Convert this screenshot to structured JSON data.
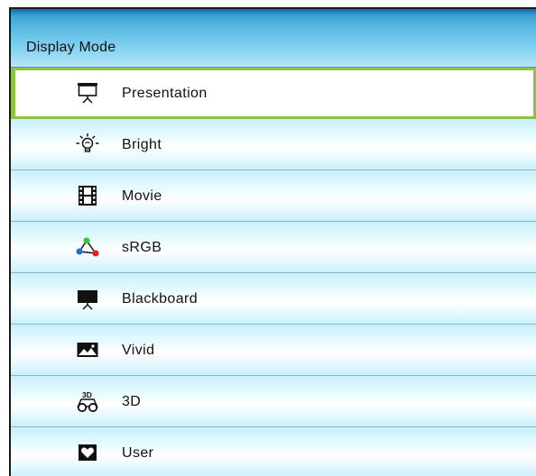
{
  "header": {
    "title": "Display Mode"
  },
  "items": [
    {
      "label": "Presentation",
      "icon": "presentation-screen-icon",
      "selected": true
    },
    {
      "label": "Bright",
      "icon": "light-bulb-icon",
      "selected": false
    },
    {
      "label": "Movie",
      "icon": "film-strip-icon",
      "selected": false
    },
    {
      "label": "sRGB",
      "icon": "srgb-triangle-icon",
      "selected": false
    },
    {
      "label": "Blackboard",
      "icon": "blackboard-icon",
      "selected": false
    },
    {
      "label": "Vivid",
      "icon": "landscape-image-icon",
      "selected": false
    },
    {
      "label": "3D",
      "icon": "3d-glasses-icon",
      "selected": false
    },
    {
      "label": "User",
      "icon": "heart-icon",
      "selected": false
    }
  ],
  "colors": {
    "selection_border": "#8bc53f",
    "header_gradient_top": "#0a6fa6",
    "header_gradient_bottom": "#b4e6f8",
    "row_tint": "#c7f0fb"
  }
}
